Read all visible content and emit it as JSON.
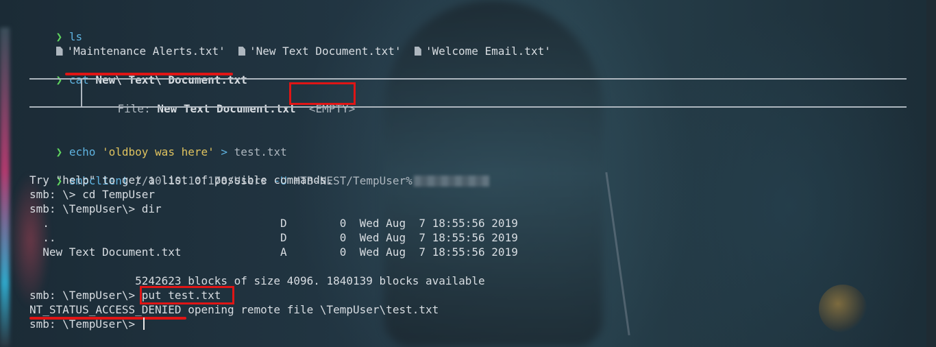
{
  "terminal": {
    "prompt_symbol": "❯",
    "ls": {
      "cmd": "ls",
      "files": [
        "'Maintenance Alerts.txt'",
        "'New Text Document.txt'",
        "'Welcome Email.txt'"
      ]
    },
    "cat": {
      "cmd": "cat",
      "arg": "New\\ Text\\ Document.txt",
      "file_label": "File:",
      "file_name": "New Text Document.txt",
      "empty_tag": "<EMPTY>"
    },
    "echo": {
      "cmd": "echo",
      "string": "'oldboy was here'",
      "redirect": ">",
      "target": "test.txt"
    },
    "smbclient": {
      "cmd": "smbclient",
      "share": "//10.10.10.178/Users",
      "flag": "-U",
      "user": "HTB-NEST/TempUser%"
    },
    "output": {
      "help_line": "Try \"help\" to get a list of possible commands.",
      "cd_line": "smb: \\> cd TempUser",
      "dir_line": "smb: \\TempUser\\> dir",
      "dir_rows": [
        "  .                                   D        0  Wed Aug  7 18:55:56 2019",
        "  ..                                  D        0  Wed Aug  7 18:55:56 2019",
        "  New Text Document.txt               A        0  Wed Aug  7 18:55:56 2019"
      ],
      "blocks_line": "                5242623 blocks of size 4096. 1840139 blocks available",
      "put_prompt": "smb: \\TempUser\\> ",
      "put_cmd": "put test.txt",
      "error_code": "NT_STATUS_ACCESS_DENIED",
      "error_rest": " opening remote file \\TempUser\\test.txt",
      "final_prompt": "smb: \\TempUser\\> "
    }
  },
  "colors": {
    "prompt": "#5fd35f",
    "command": "#5fb3e0",
    "string": "#e0c35f",
    "highlight": "#e01515"
  }
}
